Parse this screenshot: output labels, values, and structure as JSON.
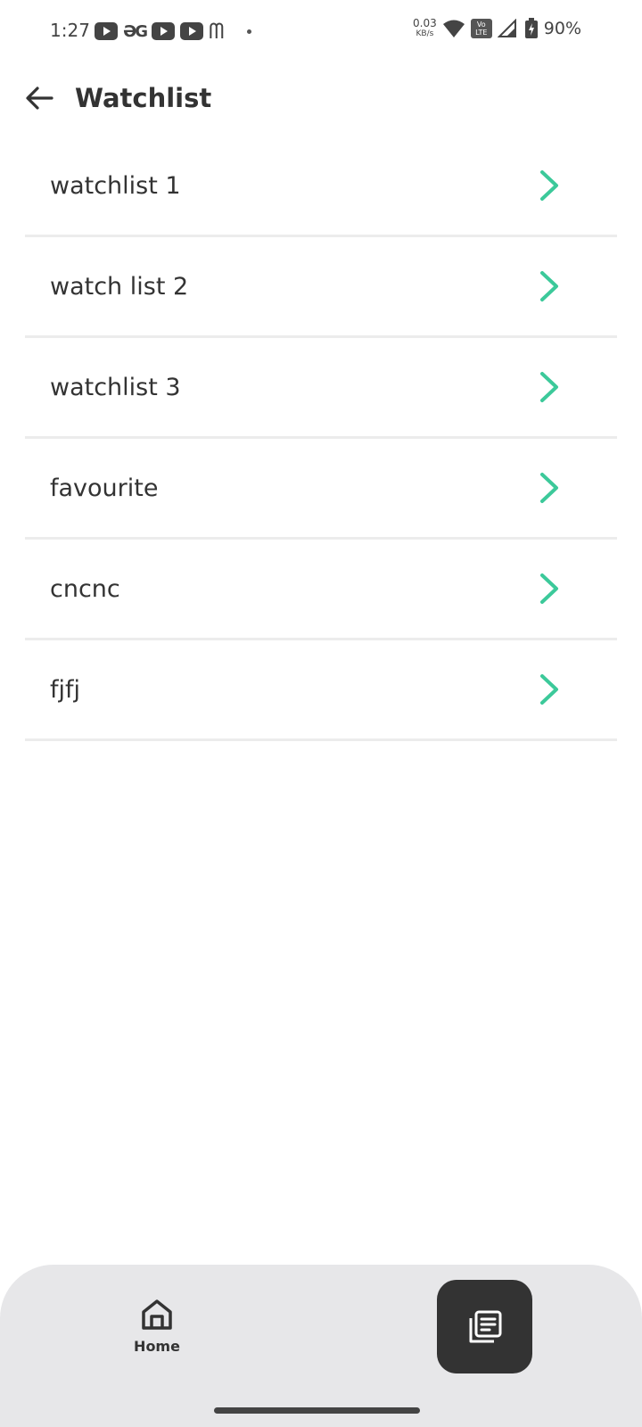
{
  "status_bar": {
    "time": "1:27",
    "net_speed_value": "0.03",
    "net_speed_unit": "KB/s",
    "volte_top": "Vo",
    "volte_bottom": "LTE",
    "battery": "90%"
  },
  "header": {
    "title": "Watchlist"
  },
  "watchlists": [
    {
      "label": "watchlist 1"
    },
    {
      "label": "watch list 2"
    },
    {
      "label": "watchlist 3"
    },
    {
      "label": "favourite"
    },
    {
      "label": "cncnc"
    },
    {
      "label": "fjfj"
    }
  ],
  "bottom_nav": {
    "home_label": "Home"
  },
  "colors": {
    "accent": "#3cc99a",
    "text": "#333333",
    "divider": "#ececec",
    "nav_background": "#e7e7e9",
    "active_tab": "#333333"
  }
}
